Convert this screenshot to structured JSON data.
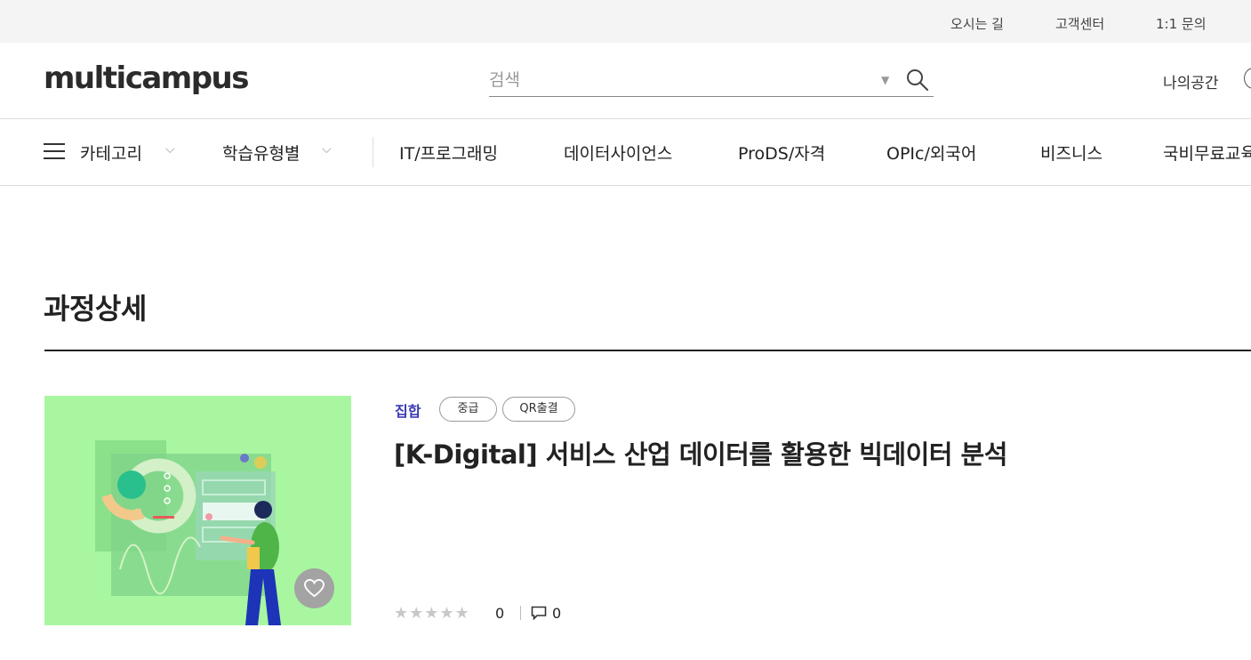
{
  "util_links": [
    "오시는 길",
    "고객센터",
    "1:1 문의"
  ],
  "header": {
    "logo": "multicampus",
    "search_placeholder": "검색",
    "myspace": "나의공간"
  },
  "nav": {
    "category": "카테고리",
    "learning_type": "학습유형별",
    "items": [
      "IT/프로그래밍",
      "데이터사이언스",
      "ProDS/자격",
      "OPIc/외국어",
      "비즈니스",
      "국비무료교육"
    ]
  },
  "page": {
    "title": "과정상세"
  },
  "course": {
    "type": "집합",
    "chips": [
      "중급",
      "QR출결"
    ],
    "title": "[K-Digital] 서비스 산업 데이터를 활용한 빅데이터 분석",
    "rating_value": 0,
    "rating_count": "0",
    "comment_count": "0"
  },
  "colors": {
    "thumb_bg": "#a8f7a0",
    "type_accent": "#3a3ab4",
    "util_bg": "#f4f4f4"
  }
}
